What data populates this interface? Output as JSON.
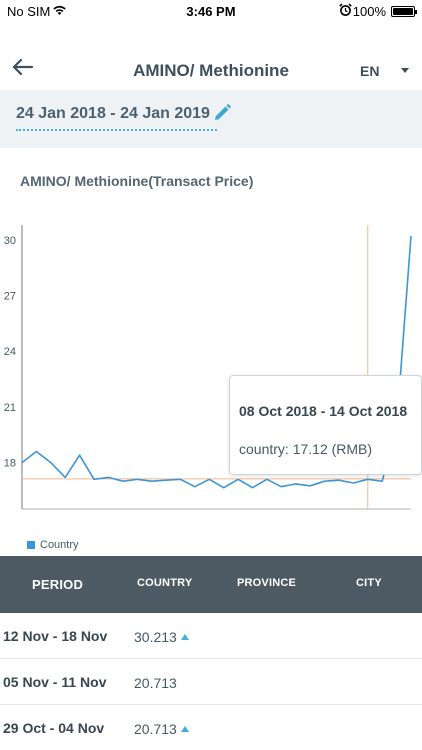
{
  "status_bar": {
    "carrier": "No SIM",
    "time": "3:46 PM",
    "battery": "100%"
  },
  "header": {
    "title": "AMINO/ Methionine",
    "language": "EN"
  },
  "date_range": {
    "text": "24 Jan 2018 - 24 Jan 2019"
  },
  "chart_title": "AMINO/ Methionine(Transact Price)",
  "tooltip": {
    "period": "08 Oct 2018 - 14 Oct 2018",
    "value": "country: 17.12 (RMB)"
  },
  "chart_data": {
    "type": "line",
    "title": "AMINO/ Methionine(Transact Price)",
    "y_ticks": [
      "30",
      "27",
      "24",
      "21",
      "18"
    ],
    "ylim": [
      15.5,
      30.8
    ],
    "series": [
      {
        "name": "Country",
        "color": "#3d95d6",
        "values": [
          18.0,
          18.6,
          18.0,
          17.2,
          18.4,
          17.1,
          17.2,
          17.0,
          17.1,
          17.0,
          17.05,
          17.1,
          16.7,
          17.1,
          16.65,
          17.1,
          16.65,
          17.1,
          16.7,
          16.85,
          16.75,
          17.0,
          17.05,
          16.9,
          17.1,
          17.0,
          20.0,
          30.2
        ]
      }
    ],
    "reference_line_value": 17.12,
    "highlight_index": 24,
    "legend": "bottom-left",
    "grid": false
  },
  "table": {
    "headers": {
      "period": "PERIOD",
      "country": "COUNTRY",
      "province": "PROVINCE",
      "city": "CITY"
    },
    "rows": [
      {
        "period": "12 Nov - 18 Nov",
        "country": "30.213",
        "trend": "up"
      },
      {
        "period": "05 Nov - 11 Nov",
        "country": "20.713",
        "trend": ""
      },
      {
        "period": "29 Oct - 04 Nov",
        "country": "20.713",
        "trend": "up"
      }
    ]
  },
  "icons": {
    "back": "arrow-left-icon",
    "edit": "pencil-icon",
    "wifi": "wifi-icon",
    "alarm": "alarm-clock-icon",
    "battery": "battery-icon",
    "dropdown": "caret-down-icon",
    "trend_up": "triangle-up-icon"
  }
}
